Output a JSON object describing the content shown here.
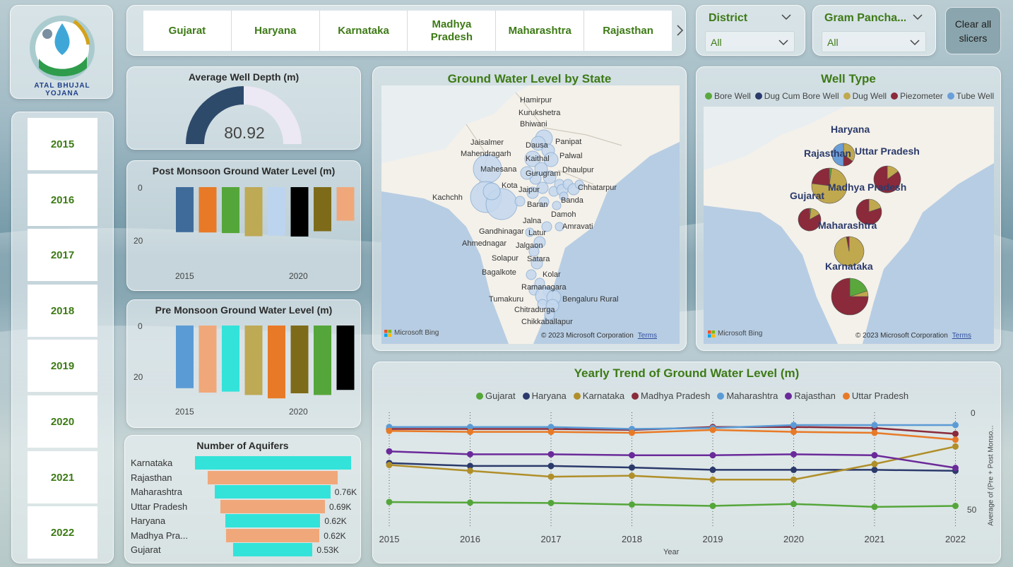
{
  "logo": {
    "text": "ATAL BHUJAL YOJANA"
  },
  "states": [
    "Gujarat",
    "Haryana",
    "Karnataka",
    "Madhya Pradesh",
    "Maharashtra",
    "Rajasthan"
  ],
  "years": [
    "2015",
    "2016",
    "2017",
    "2018",
    "2019",
    "2020",
    "2021",
    "2022"
  ],
  "slicers": {
    "district": {
      "label": "District",
      "value": "All"
    },
    "gram": {
      "label": "Gram Pancha...",
      "value": "All"
    },
    "clear_label": "Clear all slicers"
  },
  "avg_depth": {
    "title": "Average Well Depth (m)",
    "value": "80.92",
    "fraction": 0.5,
    "fill": "#2d4a6b",
    "track": "#ece8f4"
  },
  "post_monsoon": {
    "title": "Post Monsoon Ground Water Level (m)",
    "y_ticks": [
      "0",
      "20"
    ],
    "x_ticks": [
      "2015",
      "2020"
    ]
  },
  "pre_monsoon": {
    "title": "Pre Monsoon Ground Water Level (m)",
    "y_ticks": [
      "0",
      "20"
    ],
    "x_ticks": [
      "2015",
      "2020"
    ]
  },
  "aquifers": {
    "title": "Number of Aquifers",
    "rows": [
      {
        "name": "Karnataka",
        "value": "",
        "n": 1.0,
        "color": "#33e3d9"
      },
      {
        "name": "Rajasthan",
        "value": "",
        "n": 0.83,
        "color": "#f0a87a"
      },
      {
        "name": "Maharashtra",
        "value": "0.76K",
        "n": 0.74,
        "color": "#33e3d9"
      },
      {
        "name": "Uttar Pradesh",
        "value": "0.69K",
        "n": 0.67,
        "color": "#f0a87a"
      },
      {
        "name": "Haryana",
        "value": "0.62K",
        "n": 0.61,
        "color": "#33e3d9"
      },
      {
        "name": "Madhya Pra...",
        "value": "0.62K",
        "n": 0.6,
        "color": "#f0a87a"
      },
      {
        "name": "Gujarat",
        "value": "0.53K",
        "n": 0.51,
        "color": "#33e3d9"
      }
    ]
  },
  "gw_map": {
    "title": "Ground Water Level by State",
    "places": [
      "Hamirpur",
      "Kurukshetra",
      "Bhiwani",
      "Jaisalmer",
      "Dausa",
      "Panipat",
      "Mahendragarh",
      "Palwal",
      "Kaithal",
      "Mahesana",
      "Gurugram",
      "Dhaulpur",
      "Kota",
      "Chhatarpur",
      "Jaipur",
      "Kachchh",
      "Banda",
      "Baran",
      "Damoh",
      "Jalna",
      "Amravati",
      "Gandhinagar",
      "Latur",
      "Ahmednagar",
      "Jalgaon",
      "Solapur",
      "Satara",
      "Bagalkote",
      "Kolar",
      "Ramanagara",
      "Tumakuru",
      "Bengaluru Rural",
      "Chitradurga",
      "Chikkaballapur"
    ],
    "attribution": "Microsoft Bing",
    "copyright": "© 2023 Microsoft Corporation",
    "terms": "Terms"
  },
  "well_type": {
    "title": "Well Type",
    "legend": [
      {
        "name": "Bore Well",
        "color": "#5aa83c"
      },
      {
        "name": "Dug Cum Bore Well",
        "color": "#2b3a6b"
      },
      {
        "name": "Dug Well",
        "color": "#c0a84e"
      },
      {
        "name": "Piezometer",
        "color": "#8a2a3a"
      },
      {
        "name": "Tube Well",
        "color": "#6a9ed8"
      }
    ],
    "states": [
      "Haryana",
      "Rajasthan",
      "Uttar Pradesh",
      "Gujarat",
      "Madhya Pradesh",
      "Maharashtra",
      "Karnataka"
    ],
    "attribution": "Microsoft Bing",
    "copyright": "© 2023 Microsoft Corporation",
    "terms": "Terms"
  },
  "trend": {
    "title": "Yearly Trend of Ground Water Level (m)",
    "xlabel": "Year",
    "ylabel": "Average of (Pre + Post Monso...",
    "y_ticks": [
      "0",
      "50"
    ]
  },
  "chart_data": [
    {
      "type": "bar",
      "title": "Post Monsoon Ground Water Level (m)",
      "categories": [
        "2015",
        "2016",
        "2017",
        "2018",
        "2019",
        "2020",
        "2021",
        "2022"
      ],
      "values": [
        14.5,
        14.6,
        14.8,
        15.8,
        15.6,
        15.9,
        14.2,
        10.8
      ],
      "colors": [
        "#3f6b9a",
        "#e87a27",
        "#55a63a",
        "#bea955",
        "#bcd4ee",
        "#000000",
        "#7e6b1a",
        "#f0a87a"
      ],
      "ylim": [
        0,
        25
      ],
      "y_inverted": true
    },
    {
      "type": "bar",
      "title": "Pre Monsoon Ground Water Level (m)",
      "categories": [
        "2015",
        "2016",
        "2017",
        "2018",
        "2019",
        "2020",
        "2021",
        "2022"
      ],
      "values": [
        18.5,
        19.8,
        19.5,
        20.5,
        21.5,
        20.0,
        20.5,
        19.0
      ],
      "colors": [
        "#5b9bd5",
        "#f0a87a",
        "#33e3d9",
        "#bea955",
        "#e87a27",
        "#7e6b1a",
        "#55a63a",
        "#000000"
      ],
      "ylim": [
        0,
        25
      ],
      "y_inverted": true
    },
    {
      "type": "line",
      "title": "Yearly Trend of Ground Water Level (m)",
      "xlabel": "Year",
      "ylabel": "Average of (Pre + Post Monso...",
      "x": [
        "2015",
        "2016",
        "2017",
        "2018",
        "2019",
        "2020",
        "2021",
        "2022"
      ],
      "ylim": [
        0,
        50
      ],
      "y_inverted": true,
      "series": [
        {
          "name": "Gujarat",
          "color": "#55a63a",
          "values": [
            46.0,
            46.3,
            46.5,
            47.3,
            48.0,
            47.0,
            48.5,
            48.0
          ]
        },
        {
          "name": "Haryana",
          "color": "#2b3a6b",
          "values": [
            26.0,
            27.5,
            27.5,
            28.3,
            29.5,
            29.5,
            29.5,
            30.0
          ]
        },
        {
          "name": "Karnataka",
          "color": "#b08f2a",
          "values": [
            27.0,
            30.0,
            33.0,
            32.5,
            34.5,
            34.5,
            26.5,
            17.5
          ]
        },
        {
          "name": "Madhya Pradesh",
          "color": "#8a2a3a",
          "values": [
            8.5,
            8.5,
            8.5,
            9.0,
            7.5,
            7.5,
            8.0,
            11.0
          ]
        },
        {
          "name": "Maharashtra",
          "color": "#5b9bd5",
          "values": [
            7.5,
            7.5,
            7.5,
            8.5,
            8.0,
            6.5,
            6.5,
            6.5
          ]
        },
        {
          "name": "Rajasthan",
          "color": "#6a2a9a",
          "values": [
            20.0,
            21.5,
            21.5,
            22.0,
            22.0,
            21.5,
            22.0,
            28.5
          ]
        },
        {
          "name": "Uttar Pradesh",
          "color": "#e87a27",
          "values": [
            9.5,
            10.0,
            10.0,
            10.5,
            9.0,
            10.0,
            10.5,
            14.0
          ]
        }
      ]
    }
  ]
}
